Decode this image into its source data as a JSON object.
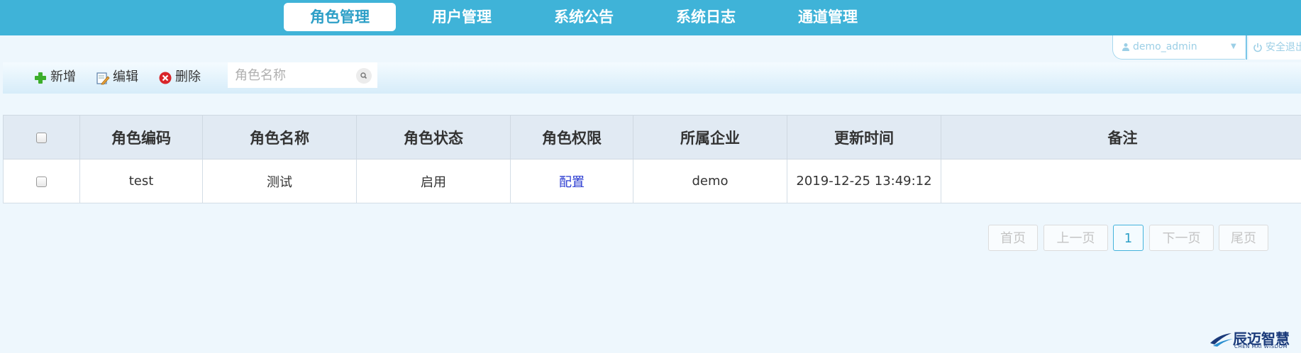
{
  "nav": {
    "tabs": [
      {
        "label": "角色管理",
        "active": true
      },
      {
        "label": "用户管理"
      },
      {
        "label": "系统公告"
      },
      {
        "label": "系统日志"
      },
      {
        "label": "通道管理"
      }
    ]
  },
  "user": {
    "name": "demo_admin",
    "logout_label": "安全退出"
  },
  "toolbar": {
    "add_label": "新增",
    "edit_label": "编辑",
    "delete_label": "删除",
    "search_placeholder": "角色名称"
  },
  "table": {
    "columns": [
      "角色编码",
      "角色名称",
      "角色状态",
      "角色权限",
      "所属企业",
      "更新时间",
      "备注"
    ],
    "rows": [
      {
        "code": "test",
        "name": "测试",
        "status": "启用",
        "permission": "配置",
        "company": "demo",
        "updated": "2019-12-25 13:49:12",
        "remark": ""
      }
    ]
  },
  "pager": {
    "first": "首页",
    "prev": "上一页",
    "current": "1",
    "next": "下一页",
    "last": "尾页"
  },
  "logo": {
    "name": "辰迈智慧",
    "subtitle": "CHEN MAI WISDOM"
  },
  "colors": {
    "nav_bg": "#3fb3d8",
    "page_bg": "#eef7fd",
    "link": "#2a3bd1"
  }
}
